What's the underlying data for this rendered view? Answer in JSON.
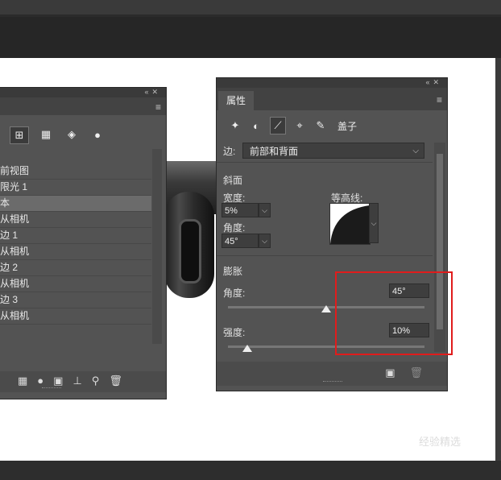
{
  "left_panel": {
    "list": [
      "前视图",
      "限光 1",
      "本",
      "从相机",
      "边 1",
      "从相机",
      "边 2",
      "从相机",
      "边 3",
      "从相机"
    ],
    "selected_index": 2
  },
  "properties": {
    "tab": "属性",
    "icon_label": "盖子",
    "side_label": "边:",
    "side_value": "前部和背面",
    "bevel": {
      "title": "斜面",
      "width_label": "宽度:",
      "width_value": "5%",
      "angle_label": "角度:",
      "angle_value": "45°",
      "contour_label": "等高线:"
    },
    "inflate": {
      "title": "膨胀",
      "angle_label": "角度:",
      "angle_value": "45°",
      "angle_level": 0.5,
      "strength_label": "强度:",
      "strength_value": "10%",
      "strength_level": 0.1
    }
  },
  "watermark": "经验精选",
  "colors": {
    "highlight": "#e01c1c",
    "panel": "#535353",
    "canvas": "#ffffff"
  }
}
